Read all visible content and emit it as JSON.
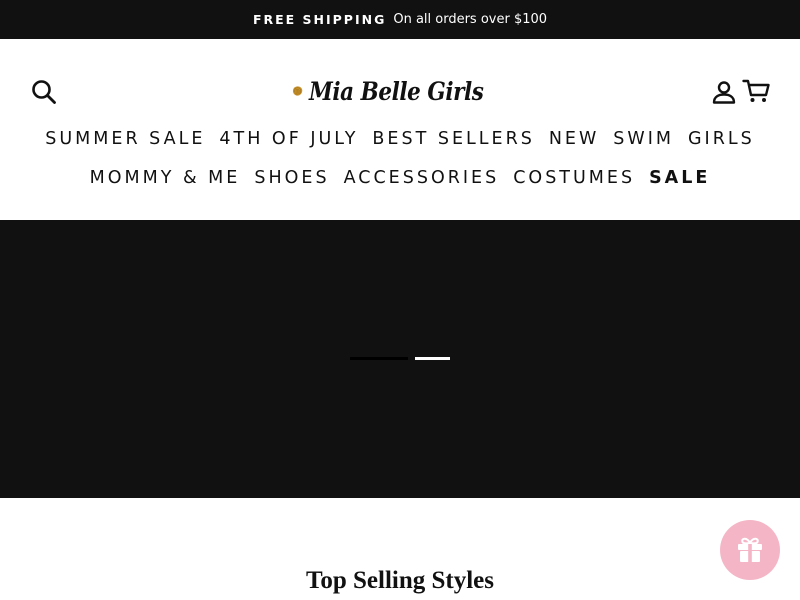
{
  "announcement": {
    "bold": "FREE SHIPPING",
    "text": "On all orders over $100"
  },
  "header": {
    "logo_text": "Mia Belle Girls",
    "icons": {
      "search": "search-icon",
      "account": "user-icon",
      "cart": "cart-icon"
    }
  },
  "nav": {
    "row1": [
      "SUMMER SALE",
      "4TH OF JULY",
      "BEST SELLERS",
      "NEW",
      "SWIM",
      "GIRLS"
    ],
    "row2": [
      "MOMMY & ME",
      "SHOES",
      "ACCESSORIES",
      "COSTUMES",
      "SALE"
    ]
  },
  "hero": {
    "slide_count": 2,
    "active_slide": 2
  },
  "section": {
    "title": "Top Selling Styles"
  },
  "floating": {
    "gift_icon": "gift-icon"
  },
  "colors": {
    "announcement_bg": "#111111",
    "hero_bg": "#111111",
    "gift_button": "#f4b6c6",
    "logo_rose": "#c8922b"
  }
}
